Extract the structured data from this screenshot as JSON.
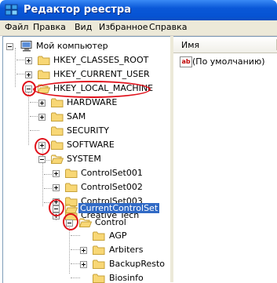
{
  "window": {
    "title": "Редактор реестра"
  },
  "menu": [
    "Файл",
    "Правка",
    "Вид",
    "Избранное",
    "Справка"
  ],
  "tree": {
    "root": "Мой компьютер",
    "items": [
      "HKEY_CLASSES_ROOT",
      "HKEY_CURRENT_USER",
      "HKEY_LOCAL_MACHINE",
      "HARDWARE",
      "SAM",
      "SECURITY",
      "SOFTWARE",
      "SYSTEM",
      "ControlSet001",
      "ControlSet002",
      "ControlSet003",
      "Creative Tech",
      "CurrentControlSet",
      "Control",
      "AGP",
      "Arbiters",
      "BackupResto",
      "Biosinfo"
    ]
  },
  "list": {
    "column_name": "Имя",
    "rows": [
      {
        "icon": "string-value-icon",
        "icon_text": "ab",
        "name": "(По умолчанию)"
      }
    ]
  },
  "colors": {
    "selection": "#316ac5",
    "annotation": "#e0101a",
    "titlebar": "#0a58d8"
  }
}
